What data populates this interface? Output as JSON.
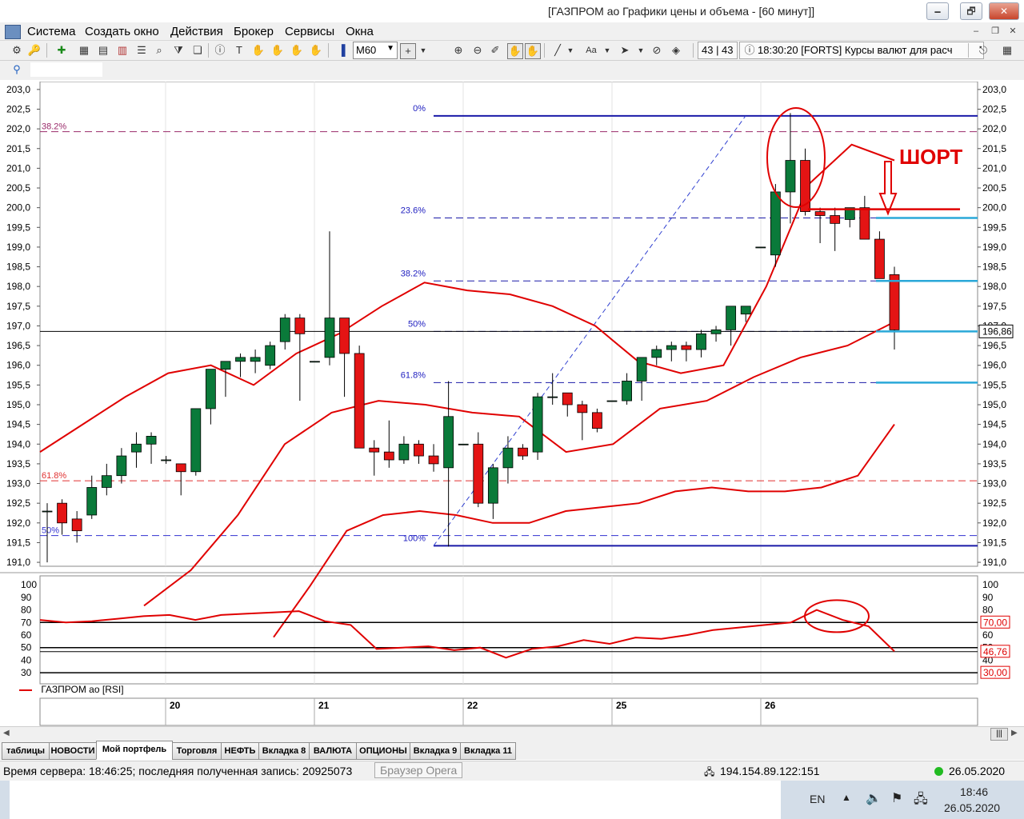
{
  "window": {
    "title": "[ГАЗПРОМ ао Графики цены и объема - [60 минут]]",
    "buttons": [
      "🗕",
      "🗗",
      "✕"
    ]
  },
  "menu": {
    "items": [
      "Система",
      "Создать окно",
      "Действия",
      "Брокер",
      "Сервисы",
      "Окна"
    ],
    "mdi_buttons": [
      "–",
      "❐",
      "✕"
    ]
  },
  "toolbar": {
    "timeframe": "M60",
    "counter": "43 | 43",
    "ticker": "18:30:20  [FORTS] Курсы валют для расч"
  },
  "chart": {
    "y_ticks": [
      "203,0",
      "202,5",
      "202,0",
      "201,5",
      "201,0",
      "200,5",
      "200,0",
      "199,5",
      "199,0",
      "198,5",
      "198,0",
      "197,5",
      "197,0",
      "196,5",
      "196,0",
      "195,5",
      "195,0",
      "194,5",
      "194,0",
      "193,5",
      "193,0",
      "192,5",
      "192,0",
      "191,5",
      "191,0"
    ],
    "price_tag": "196,86",
    "fib_levels": [
      {
        "label": "0%",
        "value": 202.33
      },
      {
        "label": "23.6%",
        "value": 199.74
      },
      {
        "label": "38.2%",
        "value": 198.14
      },
      {
        "label": "50%",
        "value": 196.86
      },
      {
        "label": "61.8%",
        "value": 195.56
      },
      {
        "label": "100%",
        "value": 191.42
      }
    ],
    "left_fib_labels": [
      {
        "label": "38.2%",
        "value": 201.93
      },
      {
        "label": "61.8%",
        "value": 193.07
      },
      {
        "label": "50%",
        "value": 191.68
      }
    ],
    "annotation": "ШОРТ",
    "date_labels": [
      "20",
      "21",
      "22",
      "25",
      "26"
    ],
    "rsi_ticks": [
      "100",
      "90",
      "80",
      "70",
      "60",
      "50",
      "40",
      "30"
    ],
    "rsi_levels": {
      "upper": "70,00",
      "current": "46,76",
      "lower": "30,00"
    },
    "legend": "ГАЗПРОМ ао [RSI]"
  },
  "chart_data": {
    "type": "candlestick",
    "title": "ГАЗПРОМ ао Графики цены и объема - [60 минут]",
    "interval": "60 минут",
    "ylim": [
      190.9,
      203.2
    ],
    "dates": [
      "20",
      "21",
      "22",
      "25",
      "26"
    ],
    "candles": [
      [
        192.3,
        192.5,
        191.0,
        192.3
      ],
      [
        192.5,
        192.6,
        191.7,
        192.0
      ],
      [
        192.1,
        192.3,
        191.5,
        191.8
      ],
      [
        192.2,
        193.2,
        192.1,
        192.9
      ],
      [
        192.9,
        193.5,
        192.7,
        193.2
      ],
      [
        193.2,
        193.9,
        193.0,
        193.7
      ],
      [
        193.8,
        194.3,
        193.4,
        194.0
      ],
      [
        194.0,
        194.3,
        193.5,
        194.2
      ],
      [
        193.6,
        193.7,
        193.5,
        193.6
      ],
      [
        193.5,
        193.5,
        192.7,
        193.3
      ],
      [
        193.3,
        194.6,
        193.2,
        194.9
      ],
      [
        194.9,
        195.8,
        194.5,
        195.9
      ],
      [
        195.9,
        196.1,
        195.2,
        196.1
      ],
      [
        196.1,
        196.3,
        195.7,
        196.2
      ],
      [
        196.1,
        196.4,
        195.8,
        196.2
      ],
      [
        196.0,
        196.6,
        195.9,
        196.5
      ],
      [
        196.6,
        197.3,
        196.4,
        197.2
      ],
      [
        197.2,
        197.3,
        195.1,
        196.8
      ],
      [
        196.1,
        196.1,
        196.1,
        196.1
      ],
      [
        196.2,
        199.4,
        196.0,
        197.2
      ],
      [
        197.2,
        197.1,
        195.2,
        196.3
      ],
      [
        196.3,
        196.5,
        193.9,
        193.9
      ],
      [
        193.9,
        194.1,
        193.2,
        193.8
      ],
      [
        193.8,
        194.6,
        193.4,
        193.6
      ],
      [
        193.6,
        194.2,
        193.5,
        194.0
      ],
      [
        194.0,
        194.1,
        193.5,
        193.7
      ],
      [
        193.7,
        194.0,
        193.3,
        193.5
      ],
      [
        193.4,
        195.6,
        191.4,
        194.7
      ],
      [
        194.0,
        194.0,
        194.0,
        194.0
      ],
      [
        194.0,
        194.3,
        192.4,
        192.5
      ],
      [
        192.5,
        193.5,
        192.1,
        193.4
      ],
      [
        193.4,
        194.2,
        193.0,
        193.9
      ],
      [
        193.9,
        194.0,
        193.6,
        193.7
      ],
      [
        193.8,
        195.3,
        193.6,
        195.2
      ],
      [
        195.2,
        195.8,
        195.0,
        195.2
      ],
      [
        195.3,
        195.3,
        194.7,
        195.0
      ],
      [
        195.0,
        195.1,
        194.1,
        194.8
      ],
      [
        194.8,
        194.9,
        194.3,
        194.4
      ],
      [
        195.1,
        195.1,
        195.1,
        195.1
      ],
      [
        195.1,
        195.8,
        195.0,
        195.6
      ],
      [
        195.6,
        196.1,
        195.1,
        196.2
      ],
      [
        196.2,
        196.5,
        196.0,
        196.4
      ],
      [
        196.4,
        196.6,
        196.1,
        196.5
      ],
      [
        196.5,
        196.6,
        196.1,
        196.4
      ],
      [
        196.4,
        196.9,
        196.2,
        196.8
      ],
      [
        196.8,
        197.0,
        196.6,
        196.9
      ],
      [
        196.9,
        197.4,
        196.5,
        197.5
      ],
      [
        197.3,
        197.5,
        197.1,
        197.5
      ],
      [
        199.0,
        199.0,
        199.0,
        199.0
      ],
      [
        198.8,
        200.6,
        198.5,
        200.4
      ],
      [
        200.4,
        202.4,
        199.6,
        201.2
      ],
      [
        201.2,
        201.5,
        199.8,
        199.9
      ],
      [
        199.9,
        200.0,
        199.1,
        199.8
      ],
      [
        199.8,
        200.0,
        198.9,
        199.6
      ],
      [
        199.7,
        200.0,
        199.5,
        200.0
      ],
      [
        200.0,
        200.3,
        199.2,
        199.2
      ],
      [
        199.2,
        199.4,
        198.2,
        198.2
      ],
      [
        198.3,
        198.5,
        196.4,
        196.9
      ]
    ],
    "bollinger": {
      "upper": [
        193.8,
        194.5,
        195.2,
        195.8,
        196.0,
        195.5,
        196.3,
        196.8,
        197.5,
        198.1,
        197.9,
        197.8,
        197.5,
        197.0,
        196.1,
        195.8,
        196.0,
        198.0,
        200.6,
        201.6,
        201.2
      ],
      "middle": [
        189.9,
        190.8,
        192.2,
        194.0,
        194.8,
        195.1,
        195.0,
        194.8,
        194.7,
        193.8,
        194.0,
        194.9,
        195.1,
        195.7,
        196.2,
        196.5,
        197.1
      ],
      "lower": [
        189.1,
        190.4,
        191.8,
        192.2,
        192.3,
        192.2,
        192.0,
        192.0,
        192.3,
        192.4,
        192.5,
        192.8,
        192.9,
        192.8,
        192.8,
        192.9,
        193.2,
        194.5
      ]
    },
    "rsi": [
      72,
      70,
      71,
      73,
      75,
      76,
      72,
      76,
      77,
      78,
      79,
      71,
      68,
      49,
      50,
      51,
      48,
      50,
      42,
      49,
      51,
      56,
      53,
      58,
      57,
      60,
      64,
      66,
      68,
      70,
      80,
      72,
      67,
      47
    ]
  }
}
